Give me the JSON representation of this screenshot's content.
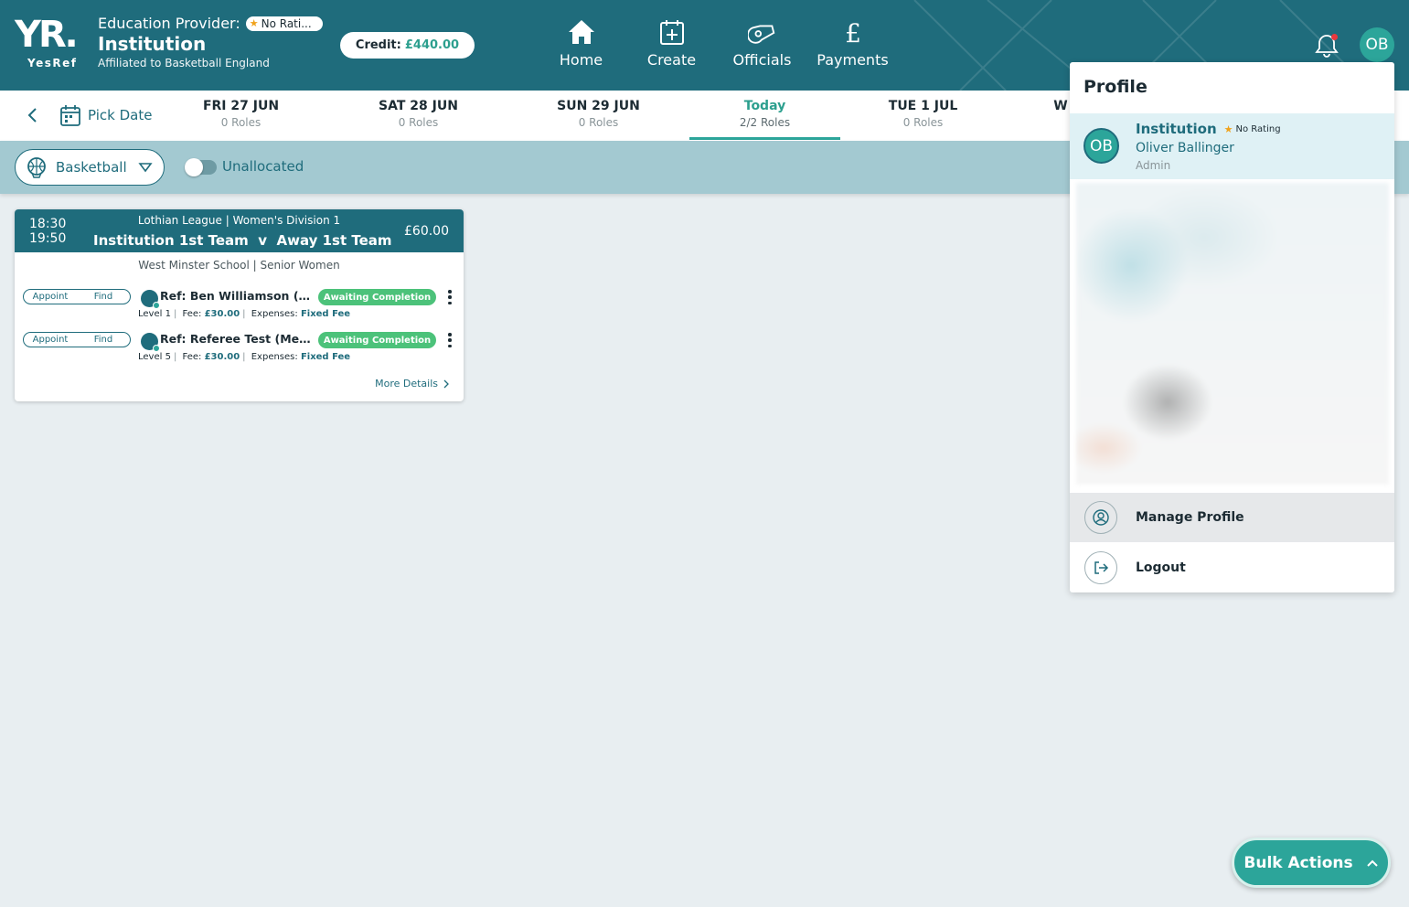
{
  "brand": {
    "logo_text": "YR.",
    "logo_sub": "YesRef"
  },
  "provider": {
    "label": "Education Provider:",
    "rating": "No Rati...",
    "name": "Institution",
    "affiliation": "Affiliated to Basketball England"
  },
  "credit": {
    "label": "Credit:",
    "amount": "£440.00"
  },
  "nav": [
    {
      "label": "Home",
      "icon": "home-icon"
    },
    {
      "label": "Create",
      "icon": "calendar-plus-icon"
    },
    {
      "label": "Officials",
      "icon": "whistle-icon"
    },
    {
      "label": "Payments",
      "icon": "pound-icon"
    }
  ],
  "user_avatar": "OB",
  "datebar": {
    "pick_date": "Pick Date",
    "days": [
      {
        "day": "FRI 27 JUN",
        "roles": "0 Roles"
      },
      {
        "day": "SAT 28 JUN",
        "roles": "0 Roles"
      },
      {
        "day": "SUN 29 JUN",
        "roles": "0 Roles"
      },
      {
        "day": "Today",
        "roles": "2/2 Roles",
        "active": true
      },
      {
        "day": "TUE 1 JUL",
        "roles": "0 Roles"
      },
      {
        "day": "W",
        "roles": ""
      }
    ]
  },
  "filters": {
    "sport": "Basketball",
    "unallocated_label": "Unallocated",
    "unallocated_on": false
  },
  "fixture": {
    "start": "18:30",
    "end": "19:50",
    "league": "Lothian League | Women's Division 1",
    "home": "Institution 1st Team",
    "vs": "v",
    "away": "Away 1st Team",
    "price": "£60.00",
    "venue": "West Minster School | Senior Women",
    "appoint_label": "Appoint",
    "find_label": "Find",
    "roles": [
      {
        "name": "Ref: Ben Williamson (Mel...",
        "status": "Awaiting Completion",
        "level": "Level 1",
        "fee_label": "Fee:",
        "fee": "£30.00",
        "expenses_label": "Expenses:",
        "expenses": "Fixed Fee"
      },
      {
        "name": "Ref: Referee Test (Melksh...",
        "status": "Awaiting Completion",
        "level": "Level 5",
        "fee_label": "Fee:",
        "fee": "£30.00",
        "expenses_label": "Expenses:",
        "expenses": "Fixed Fee"
      }
    ],
    "more_details": "More Details"
  },
  "profile_menu": {
    "title": "Profile",
    "org": "Institution",
    "rating": "No Rating",
    "user_name": "Oliver Ballinger",
    "user_role": "Admin",
    "avatar": "OB",
    "items": [
      {
        "label": "Manage Profile",
        "icon": "user-circle-icon"
      },
      {
        "label": "Logout",
        "icon": "logout-icon"
      }
    ]
  },
  "bulk_actions": "Bulk Actions",
  "colors": {
    "primary": "#1f6c7c",
    "accent": "#2ca59a",
    "status_green": "#4cc27a",
    "star": "#f0a21b"
  }
}
